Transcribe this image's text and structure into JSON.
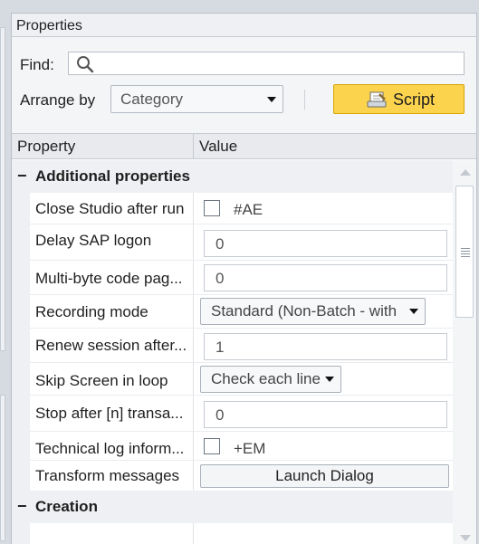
{
  "panel": {
    "title": "Properties"
  },
  "find": {
    "label": "Find:",
    "value": ""
  },
  "arrange": {
    "label": "Arrange by",
    "selected": "Category"
  },
  "script_button": {
    "label": "Script"
  },
  "grid": {
    "col_property": "Property",
    "col_value": "Value",
    "categories": [
      {
        "label": "Additional properties",
        "expanded": true
      },
      {
        "label": "Creation",
        "expanded": true
      }
    ],
    "rows": [
      {
        "name": "Close Studio after run",
        "type": "checkbox",
        "checked": false,
        "value": "#AE"
      },
      {
        "name": "Delay SAP logon",
        "type": "text",
        "value": "0"
      },
      {
        "name": "Multi-byte code pag...",
        "type": "text",
        "value": "0"
      },
      {
        "name": "Recording mode",
        "type": "dropdown",
        "value": "Standard (Non-Batch - with"
      },
      {
        "name": "Renew session after...",
        "type": "text",
        "value": "1"
      },
      {
        "name": "Skip Screen in loop",
        "type": "dropdown",
        "value": "Check each line"
      },
      {
        "name": "Stop after [n] transa...",
        "type": "text",
        "value": "0"
      },
      {
        "name": "Technical log inform...",
        "type": "checkbox",
        "checked": false,
        "value": "+EM"
      },
      {
        "name": "Transform messages",
        "type": "button",
        "value": "Launch Dialog"
      }
    ]
  },
  "icons": [
    "search-icon",
    "script-icon",
    "collapse-icon",
    "chevron-down-icon",
    "scroll-up-icon",
    "scroll-down-icon"
  ],
  "colors": {
    "accent": "#fbd34d",
    "panel_bg": "#f4f5f7",
    "header_bg": "#e8eaee"
  }
}
